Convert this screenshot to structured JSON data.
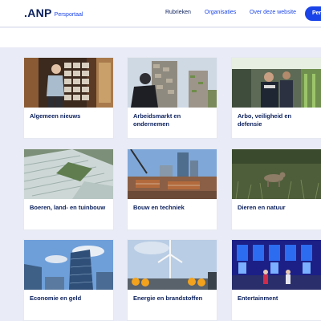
{
  "header": {
    "logo_text": ".ANP",
    "logo_sub": "Persportaal",
    "nav": [
      "Rubrieken",
      "Organisaties",
      "Over deze website"
    ],
    "cta_label": "Per"
  },
  "categories": [
    {
      "label": "Algemeen nieuws",
      "image": "postcard-rack-elderly-man-photo"
    },
    {
      "label": "Arbeidsmarkt en ondernemen",
      "image": "high-rise-construction-worker-photo"
    },
    {
      "label": "Arbo, veiligheid en defensie",
      "image": "security-officer-station-photo"
    },
    {
      "label": "Boeren, land- en tuinbouw",
      "image": "greenhouses-aerial-photo"
    },
    {
      "label": "Bouw en techniek",
      "image": "construction-site-skyline-photo"
    },
    {
      "label": "Dieren en natuur",
      "image": "wolf-in-grass-photo"
    },
    {
      "label": "Economie en geld",
      "image": "glass-office-towers-photo"
    },
    {
      "label": "Energie en brandstoffen",
      "image": "wind-turbine-pipes-photo"
    },
    {
      "label": "Entertainment",
      "image": "stage-show-lights-photo"
    }
  ],
  "colors": {
    "brand": "#1a44e8",
    "navy": "#0a1f5c",
    "page_bg": "#e9ebf6"
  }
}
